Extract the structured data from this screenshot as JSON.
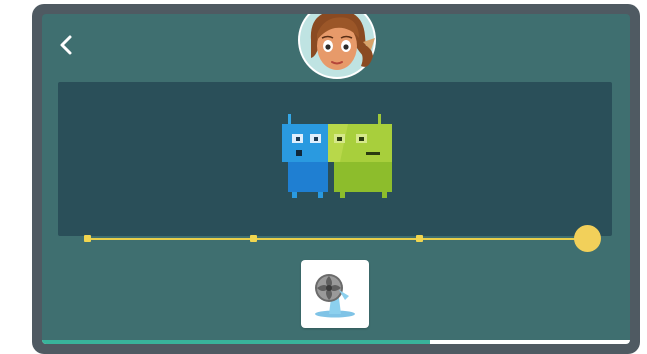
{
  "colors": {
    "screen_bg": "#3f6f70",
    "stage_bg": "#2a4f59",
    "timeline_yellow": "#f2d05a",
    "progress_fill": "#39b39b"
  },
  "icons": {
    "back": "chevron-left-icon",
    "avatar": "girl-avatar",
    "robots": "two-robots-illustration",
    "item": "desk-fan-icon"
  },
  "timeline": {
    "points": 4,
    "selected_index": 3
  },
  "progress": {
    "fraction": 0.66
  }
}
